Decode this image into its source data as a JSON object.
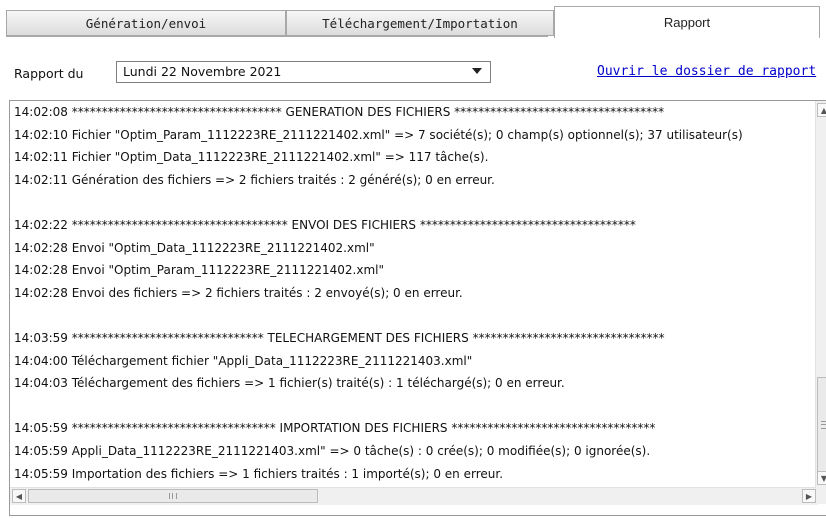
{
  "tabs": [
    {
      "label": "Génération/envoi"
    },
    {
      "label": "Téléchargement/Importation"
    },
    {
      "label": "Rapport"
    }
  ],
  "report": {
    "label": "Rapport du",
    "selected_date": "Lundi 22 Novembre 2021",
    "open_folder_link": "Ouvrir le dossier de rapport"
  },
  "log_lines": [
    "14:02:08 *********************************** GENERATION DES FICHIERS ***********************************",
    "14:02:10 Fichier \"Optim_Param_1112223RE_2111221402.xml\" => 7 société(s); 0 champ(s) optionnel(s); 37 utilisateur(s)",
    "14:02:11 Fichier \"Optim_Data_1112223RE_2111221402.xml\" => 117 tâche(s).",
    "14:02:11 Génération des fichiers => 2 fichiers traités : 2 généré(s); 0 en erreur.",
    "",
    "14:02:22 ************************************ ENVOI DES FICHIERS ************************************",
    "14:02:28 Envoi \"Optim_Data_1112223RE_2111221402.xml\"",
    "14:02:28 Envoi \"Optim_Param_1112223RE_2111221402.xml\"",
    "14:02:28 Envoi des fichiers => 2 fichiers traités : 2 envoyé(s); 0 en erreur.",
    "",
    "14:03:59 ******************************** TELECHARGEMENT DES FICHIERS ********************************",
    "14:04:00 Téléchargement fichier \"Appli_Data_1112223RE_2111221403.xml\"",
    "14:04:03 Téléchargement des fichiers => 1 fichier(s) traité(s) : 1 téléchargé(s); 0 en erreur.",
    "",
    "14:05:59 ********************************** IMPORTATION DES FICHIERS **********************************",
    "14:05:59 Appli_Data_1112223RE_2111221403.xml\" => 0 tâche(s) : 0 crée(s); 0 modifiée(s); 0 ignorée(s).",
    "14:05:59 Importation des fichiers => 1 fichiers traités : 1 importé(s); 0 en erreur."
  ]
}
